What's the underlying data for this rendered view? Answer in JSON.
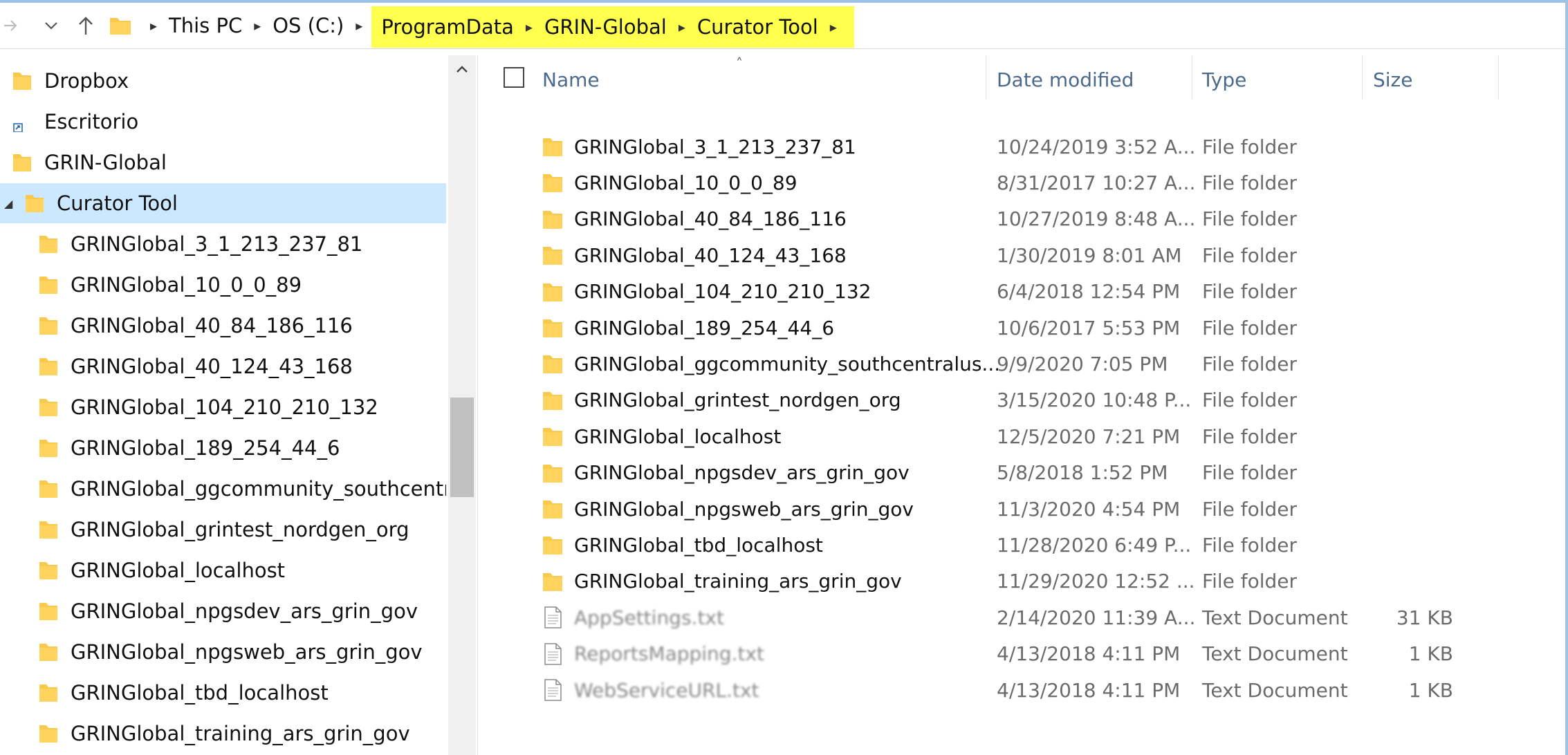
{
  "address": {
    "crumbs": [
      {
        "label": "This PC",
        "highlighted": false
      },
      {
        "label": "OS (C:)",
        "highlighted": false
      },
      {
        "label": "ProgramData",
        "highlighted": true
      },
      {
        "label": "GRIN-Global",
        "highlighted": true
      },
      {
        "label": "Curator Tool",
        "highlighted": true
      }
    ],
    "highlight_color": "#ffff4d"
  },
  "navpane": {
    "items": [
      {
        "label": "Dropbox",
        "icon": "dropbox-folder-icon",
        "indent": 0
      },
      {
        "label": "Escritorio",
        "icon": "shortcut-folder-icon",
        "indent": 0
      },
      {
        "label": "GRIN-Global",
        "icon": "folder-icon",
        "indent": 0
      },
      {
        "label": "Curator Tool",
        "icon": "folder-icon",
        "indent": 1,
        "selected": true,
        "expanded": true
      },
      {
        "label": "GRINGlobal_3_1_213_237_81",
        "icon": "folder-icon",
        "indent": 2
      },
      {
        "label": "GRINGlobal_10_0_0_89",
        "icon": "folder-icon",
        "indent": 2
      },
      {
        "label": "GRINGlobal_40_84_186_116",
        "icon": "folder-icon",
        "indent": 2
      },
      {
        "label": "GRINGlobal_40_124_43_168",
        "icon": "folder-icon",
        "indent": 2
      },
      {
        "label": "GRINGlobal_104_210_210_132",
        "icon": "folder-icon",
        "indent": 2
      },
      {
        "label": "GRINGlobal_189_254_44_6",
        "icon": "folder-icon",
        "indent": 2
      },
      {
        "label": "GRINGlobal_ggcommunity_southcentralus",
        "icon": "folder-icon",
        "indent": 2
      },
      {
        "label": "GRINGlobal_grintest_nordgen_org",
        "icon": "folder-icon",
        "indent": 2
      },
      {
        "label": "GRINGlobal_localhost",
        "icon": "folder-icon",
        "indent": 2
      },
      {
        "label": "GRINGlobal_npgsdev_ars_grin_gov",
        "icon": "folder-icon",
        "indent": 2
      },
      {
        "label": "GRINGlobal_npgsweb_ars_grin_gov",
        "icon": "folder-icon",
        "indent": 2
      },
      {
        "label": "GRINGlobal_tbd_localhost",
        "icon": "folder-icon",
        "indent": 2
      },
      {
        "label": "GRINGlobal_training_ars_grin_gov",
        "icon": "folder-icon",
        "indent": 2
      }
    ],
    "selected_color": "#cce8ff"
  },
  "filelist": {
    "columns": {
      "name": "Name",
      "date": "Date modified",
      "type": "Type",
      "size": "Size"
    },
    "rows": [
      {
        "name": "GRINGlobal_3_1_213_237_81",
        "date": "10/24/2019 3:52 A...",
        "type": "File folder",
        "size": "",
        "kind": "folder"
      },
      {
        "name": "GRINGlobal_10_0_0_89",
        "date": "8/31/2017 10:27 A...",
        "type": "File folder",
        "size": "",
        "kind": "folder"
      },
      {
        "name": "GRINGlobal_40_84_186_116",
        "date": "10/27/2019 8:48 A...",
        "type": "File folder",
        "size": "",
        "kind": "folder"
      },
      {
        "name": "GRINGlobal_40_124_43_168",
        "date": "1/30/2019 8:01 AM",
        "type": "File folder",
        "size": "",
        "kind": "folder"
      },
      {
        "name": "GRINGlobal_104_210_210_132",
        "date": "6/4/2018 12:54 PM",
        "type": "File folder",
        "size": "",
        "kind": "folder"
      },
      {
        "name": "GRINGlobal_189_254_44_6",
        "date": "10/6/2017 5:53 PM",
        "type": "File folder",
        "size": "",
        "kind": "folder"
      },
      {
        "name": "GRINGlobal_ggcommunity_southcentralus...",
        "date": "9/9/2020 7:05 PM",
        "type": "File folder",
        "size": "",
        "kind": "folder"
      },
      {
        "name": "GRINGlobal_grintest_nordgen_org",
        "date": "3/15/2020 10:48 P...",
        "type": "File folder",
        "size": "",
        "kind": "folder"
      },
      {
        "name": "GRINGlobal_localhost",
        "date": "12/5/2020 7:21 PM",
        "type": "File folder",
        "size": "",
        "kind": "folder"
      },
      {
        "name": "GRINGlobal_npgsdev_ars_grin_gov",
        "date": "5/8/2018 1:52 PM",
        "type": "File folder",
        "size": "",
        "kind": "folder"
      },
      {
        "name": "GRINGlobal_npgsweb_ars_grin_gov",
        "date": "11/3/2020 4:54 PM",
        "type": "File folder",
        "size": "",
        "kind": "folder"
      },
      {
        "name": "GRINGlobal_tbd_localhost",
        "date": "11/28/2020 6:49 P...",
        "type": "File folder",
        "size": "",
        "kind": "folder"
      },
      {
        "name": "GRINGlobal_training_ars_grin_gov",
        "date": "11/29/2020 12:52 ...",
        "type": "File folder",
        "size": "",
        "kind": "folder"
      },
      {
        "name": "AppSettings.txt",
        "date": "2/14/2020 11:39 A...",
        "type": "Text Document",
        "size": "31 KB",
        "kind": "text",
        "blurred": true
      },
      {
        "name": "ReportsMapping.txt",
        "date": "4/13/2018 4:11 PM",
        "type": "Text Document",
        "size": "1 KB",
        "kind": "text",
        "blurred": true
      },
      {
        "name": "WebServiceURL.txt",
        "date": "4/13/2018 4:11 PM",
        "type": "Text Document",
        "size": "1 KB",
        "kind": "text",
        "blurred": true
      }
    ]
  },
  "colors": {
    "folder": "#f8c94a",
    "header_text": "#4b6a8c",
    "window_accent": "#9dc3e6"
  }
}
